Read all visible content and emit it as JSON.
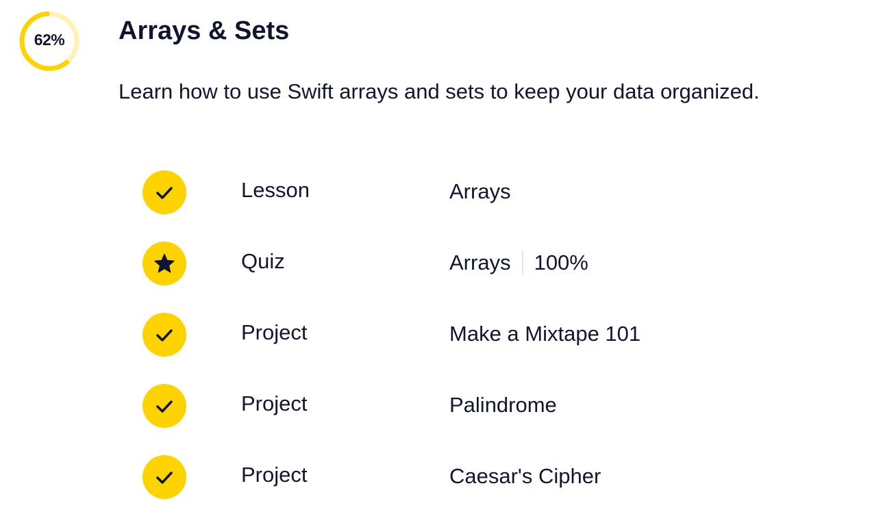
{
  "module": {
    "progress_percent": 62,
    "progress_label": "62%",
    "title": "Arrays & Sets",
    "description": "Learn how to use Swift arrays and sets to keep your data organized."
  },
  "colors": {
    "accent": "#ffd300",
    "ring_track": "#fff2b3",
    "text": "#10162f",
    "divider": "#e5e5e5"
  },
  "items": [
    {
      "status_icon": "checkmark-icon",
      "type": "Lesson",
      "name": "Arrays",
      "score": ""
    },
    {
      "status_icon": "star-icon",
      "type": "Quiz",
      "name": "Arrays",
      "score": "100%"
    },
    {
      "status_icon": "checkmark-icon",
      "type": "Project",
      "name": "Make a Mixtape 101",
      "score": ""
    },
    {
      "status_icon": "checkmark-icon",
      "type": "Project",
      "name": "Palindrome",
      "score": ""
    },
    {
      "status_icon": "checkmark-icon",
      "type": "Project",
      "name": "Caesar's Cipher",
      "score": ""
    }
  ]
}
